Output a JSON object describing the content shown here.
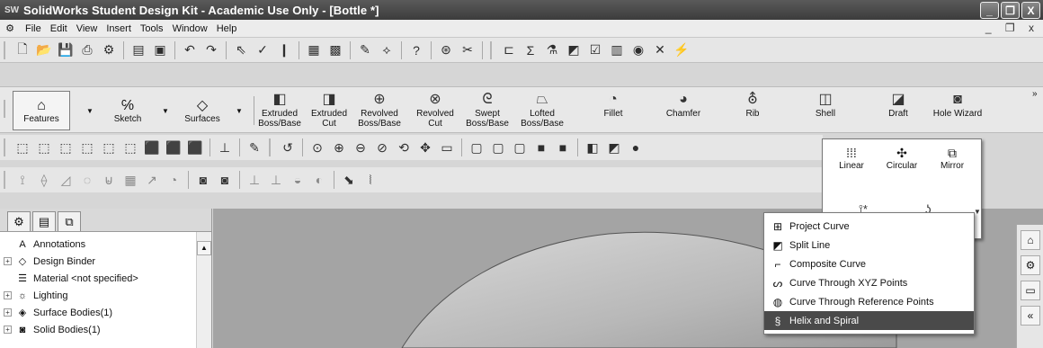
{
  "window": {
    "title": "SolidWorks Student Design Kit - Academic Use Only - [Bottle *]",
    "app_icon": "SW",
    "controls": [
      "_",
      "❐",
      "X"
    ]
  },
  "menubar": {
    "items": [
      "File",
      "Edit",
      "View",
      "Insert",
      "Tools",
      "Window",
      "Help"
    ],
    "doc_controls": "_ ❐ x"
  },
  "command_manager": {
    "tabs": [
      {
        "label": "Features",
        "icon": "features-icon"
      },
      {
        "label": "Sketch",
        "icon": "sketch-icon"
      },
      {
        "label": "Surfaces",
        "icon": "surfaces-icon"
      }
    ],
    "buttons": [
      {
        "label": "Extruded Boss/Base",
        "icon": "extruded-boss-icon"
      },
      {
        "label": "Extruded Cut",
        "icon": "extruded-cut-icon"
      },
      {
        "label": "Revolved Boss/Base",
        "icon": "revolved-boss-icon"
      },
      {
        "label": "Revolved Cut",
        "icon": "revolved-cut-icon"
      },
      {
        "label": "Swept Boss/Base",
        "icon": "swept-boss-icon"
      },
      {
        "label": "Lofted Boss/Base",
        "icon": "lofted-boss-icon"
      },
      {
        "label": "Fillet",
        "icon": "fillet-icon"
      },
      {
        "label": "Chamfer",
        "icon": "chamfer-icon"
      },
      {
        "label": "Rib",
        "icon": "rib-icon"
      },
      {
        "label": "Shell",
        "icon": "shell-icon"
      },
      {
        "label": "Draft",
        "icon": "draft-icon"
      },
      {
        "label": "Hole Wizard",
        "icon": "hole-wizard-icon"
      }
    ]
  },
  "pattern_flyout": {
    "buttons": [
      {
        "label": "Linear",
        "icon": "linear-pattern-icon"
      },
      {
        "label": "Circular",
        "icon": "circular-pattern-icon"
      },
      {
        "label": "Mirror",
        "icon": "mirror-icon"
      }
    ]
  },
  "curves_menu": {
    "items": [
      {
        "label": "Project Curve",
        "icon": "project-curve-icon"
      },
      {
        "label": "Split Line",
        "icon": "split-line-icon"
      },
      {
        "label": "Composite Curve",
        "icon": "composite-curve-icon"
      },
      {
        "label": "Curve Through XYZ Points",
        "icon": "curve-xyz-icon"
      },
      {
        "label": "Curve Through Reference Points",
        "icon": "curve-reference-icon"
      },
      {
        "label": "Helix and Spiral",
        "icon": "helix-spiral-icon"
      }
    ],
    "selected": "Helix and Spiral"
  },
  "feature_tree": {
    "items": [
      {
        "label": "Annotations",
        "icon": "annotations-icon",
        "expandable": false
      },
      {
        "label": "Design Binder",
        "icon": "design-binder-icon",
        "expandable": true
      },
      {
        "label": "Material <not specified>",
        "icon": "material-icon",
        "expandable": false
      },
      {
        "label": "Lighting",
        "icon": "lighting-icon",
        "expandable": true
      },
      {
        "label": "Surface Bodies(1)",
        "icon": "surface-bodies-icon",
        "expandable": true
      },
      {
        "label": "Solid Bodies(1)",
        "icon": "solid-bodies-icon",
        "expandable": true
      }
    ]
  }
}
